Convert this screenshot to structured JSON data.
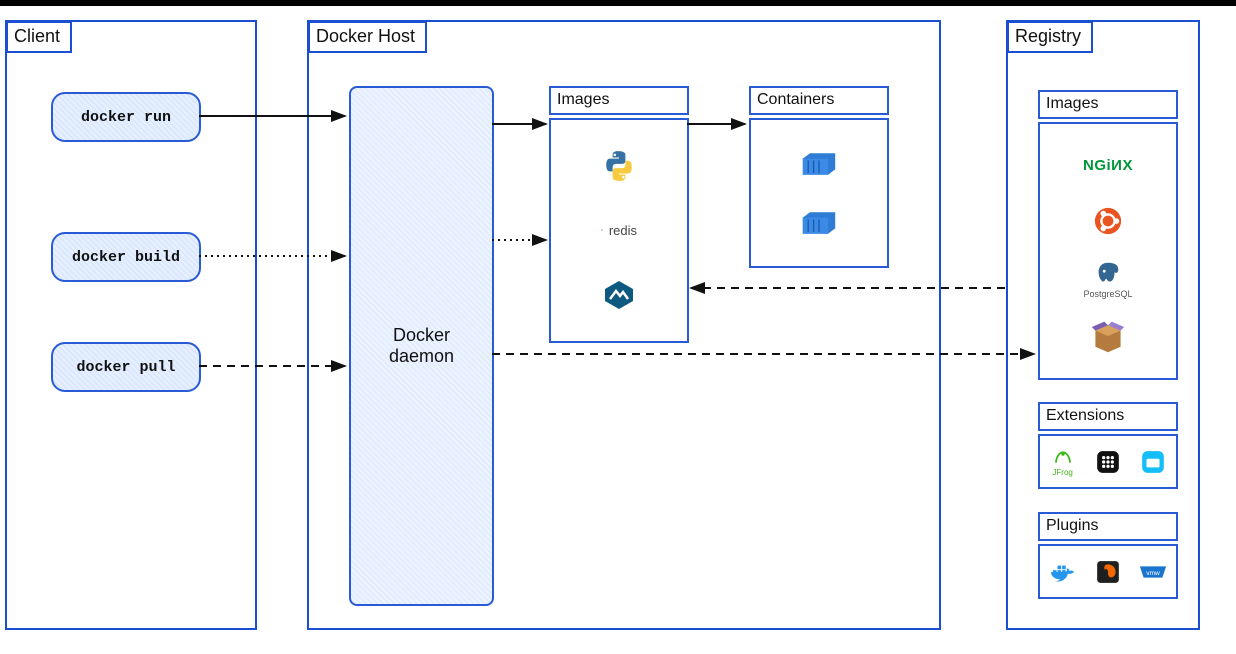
{
  "panels": {
    "client": {
      "title": "Client"
    },
    "host": {
      "title": "Docker Host"
    },
    "registry": {
      "title": "Registry"
    }
  },
  "client_commands": {
    "run": "docker run",
    "build": "docker build",
    "pull": "docker pull"
  },
  "host": {
    "daemon_label": "Docker\ndaemon",
    "images_label": "Images",
    "containers_label": "Containers",
    "images": [
      "python",
      "redis",
      "alpine"
    ],
    "containers": [
      "container-1",
      "container-2"
    ]
  },
  "registry": {
    "images_label": "Images",
    "extensions_label": "Extensions",
    "plugins_label": "Plugins",
    "images": [
      {
        "name": "NGINX",
        "label": "NGINX"
      },
      {
        "name": "ubuntu",
        "label": ""
      },
      {
        "name": "postgresql",
        "label": "PostgreSQL"
      },
      {
        "name": "box",
        "label": ""
      }
    ],
    "extensions": [
      "JFrog",
      "grid",
      "portainer"
    ],
    "plugins": [
      "docker",
      "grafana",
      "vmw"
    ]
  },
  "arrows": [
    {
      "from": "docker-run",
      "to": "daemon",
      "style": "solid"
    },
    {
      "from": "docker-build",
      "to": "daemon",
      "style": "dotted"
    },
    {
      "from": "docker-pull",
      "to": "daemon",
      "style": "dashed"
    },
    {
      "from": "daemon",
      "to": "images",
      "style": "solid"
    },
    {
      "from": "daemon",
      "to": "images",
      "style": "dotted"
    },
    {
      "from": "images",
      "to": "containers",
      "style": "solid"
    },
    {
      "from": "registry",
      "to": "images",
      "style": "dashed"
    },
    {
      "from": "daemon",
      "to": "registry",
      "style": "dashed"
    }
  ]
}
